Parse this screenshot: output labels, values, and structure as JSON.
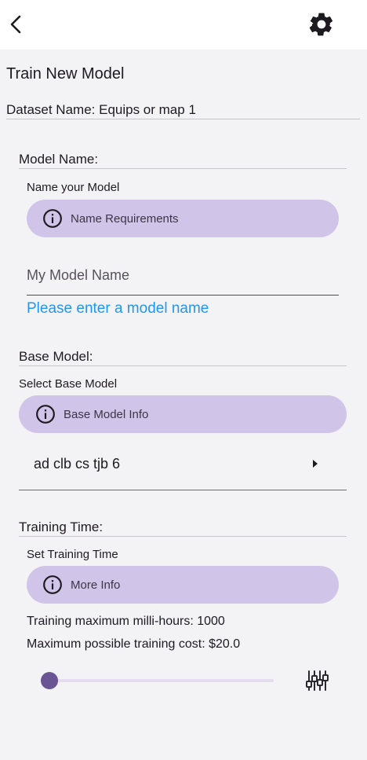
{
  "header": {
    "back_icon": "arrow-back-icon",
    "settings_icon": "gear-icon"
  },
  "page": {
    "title": "Train New Model",
    "dataset_label": "Dataset Name: Equips or map 1"
  },
  "model_name": {
    "section_title": "Model Name:",
    "sub_label": "Name your Model",
    "info_button_label": "Name Requirements",
    "input_value": "",
    "input_placeholder": "My Model Name",
    "error_text": "Please enter a model name"
  },
  "base_model": {
    "section_title": "Base Model:",
    "sub_label": "Select Base Model",
    "info_button_label": "Base Model Info",
    "selected_value": "ad clb cs tjb 6"
  },
  "training_time": {
    "section_title": "Training Time:",
    "sub_label": "Set Training Time",
    "info_button_label": "More Info",
    "max_milli_hours_text": "Training maximum milli-hours: 1000",
    "max_cost_text": "Maximum possible training cost: $20.0",
    "slider_fraction": 0.0
  },
  "colors": {
    "pill_bg": "#d1c4e9",
    "slider_thumb": "#6a5494",
    "error_underline": "#b3261e",
    "error_text": "#2196f3"
  }
}
